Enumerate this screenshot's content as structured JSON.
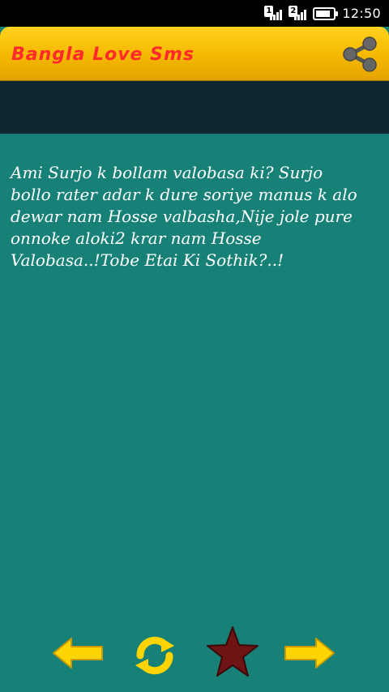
{
  "status_bar": {
    "sim1_label": "1",
    "sim2_label": "2",
    "battery_level": 0.85,
    "time": "12:50"
  },
  "app_bar": {
    "title": "Bangla Love Sms",
    "share_icon": "share-icon"
  },
  "message": {
    "text": "Ami Surjo k bollam valobasa ki? Surjo\nbollo rater adar k dure soriye manus k alo\ndewar nam Hosse valbasha,Nije jole pure\nonnoke aloki2 krar nam Hosse\nValobasa..!Tobe Etai Ki Sothik?..!"
  },
  "controls": {
    "prev_icon": "arrow-left-icon",
    "refresh_icon": "refresh-icon",
    "favorite_icon": "star-icon",
    "next_icon": "arrow-right-icon"
  },
  "colors": {
    "background": "#178178",
    "app_bar": "#f5b800",
    "title": "#ff2a2a",
    "strip": "#0f2733",
    "icon_yellow": "#ffd400",
    "star": "#6e1414"
  }
}
